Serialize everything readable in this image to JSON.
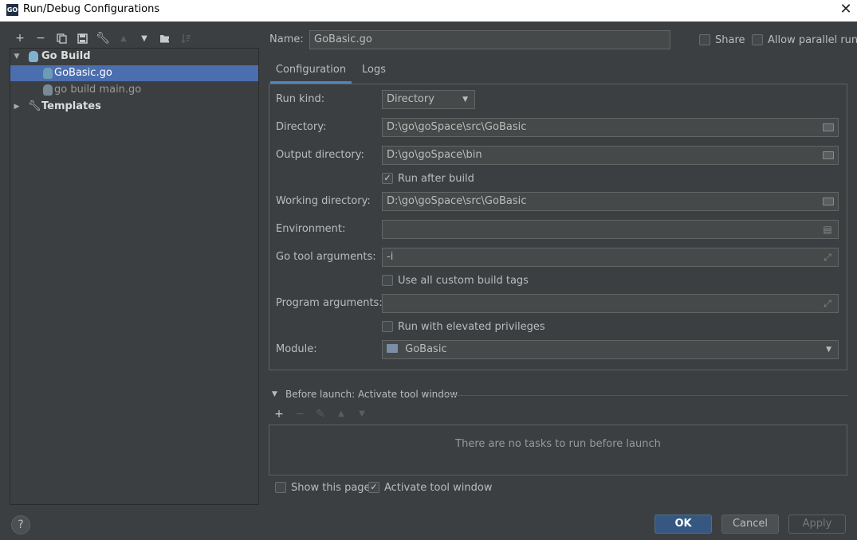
{
  "window": {
    "title": "Run/Debug Configurations",
    "app_icon_text": "GO"
  },
  "tree": {
    "group": "Go Build",
    "items": [
      {
        "label": "GoBasic.go",
        "selected": true
      },
      {
        "label": "go build main.go",
        "selected": false
      }
    ],
    "templates": "Templates"
  },
  "header": {
    "name_label": "Name:",
    "name_value": "GoBasic.go",
    "share_label": "Share",
    "parallel_label": "Allow parallel run"
  },
  "tabs": [
    "Configuration",
    "Logs"
  ],
  "form": {
    "run_kind_label": "Run kind:",
    "run_kind_value": "Directory",
    "directory_label": "Directory:",
    "directory_value": "D:\\go\\goSpace\\src\\GoBasic",
    "output_label": "Output directory:",
    "output_value": "D:\\go\\goSpace\\bin",
    "run_after_build_label": "Run after build",
    "working_label": "Working directory:",
    "working_value": "D:\\go\\goSpace\\src\\GoBasic",
    "env_label": "Environment:",
    "env_value": "",
    "go_tool_label": "Go tool arguments:",
    "go_tool_value": "-i",
    "custom_tags_label": "Use all custom build tags",
    "program_args_label": "Program arguments:",
    "program_args_value": "",
    "elevated_label": "Run with elevated privileges",
    "module_label": "Module:",
    "module_value": "GoBasic"
  },
  "before_launch": {
    "title": "Before launch: Activate tool window",
    "empty_text": "There are no tasks to run before launch",
    "show_page_label": "Show this page",
    "activate_label": "Activate tool window"
  },
  "buttons": {
    "ok": "OK",
    "cancel": "Cancel",
    "apply": "Apply",
    "help": "?"
  },
  "colors": {
    "accent": "#4a88c7",
    "selection": "#4b6eaf",
    "background": "#3c3f41",
    "primary_button": "#365880"
  }
}
